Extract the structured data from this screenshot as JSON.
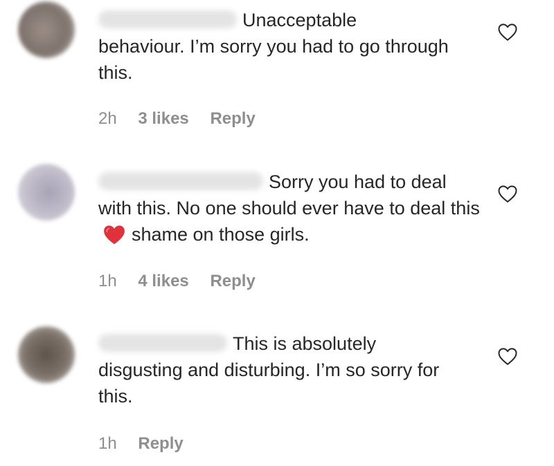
{
  "comments": [
    {
      "text_first": "Unacceptable",
      "text_rest": "behaviour. I’m sorry you had to go through this.",
      "time": "2h",
      "likes": "3 likes",
      "reply_label": "Reply",
      "avatar_color": "#8a7f78"
    },
    {
      "text_first": "Sorry you had to deal",
      "text_rest_a": "with this. No one should ever have to deal this",
      "text_rest_b": "shame on those girls.",
      "emoji": "heart-emoji",
      "time": "1h",
      "likes": "4 likes",
      "reply_label": "Reply",
      "avatar_color": "#b8b4c2"
    },
    {
      "text_first": "This is absolutely",
      "text_rest": "disgusting and disturbing. I’m so sorry for this.",
      "time": "1h",
      "reply_label": "Reply",
      "avatar_color": "#6c625a"
    }
  ],
  "colors": {
    "text": "#262626",
    "meta": "#8e8e8e",
    "heart_emoji": "#e0323c"
  }
}
